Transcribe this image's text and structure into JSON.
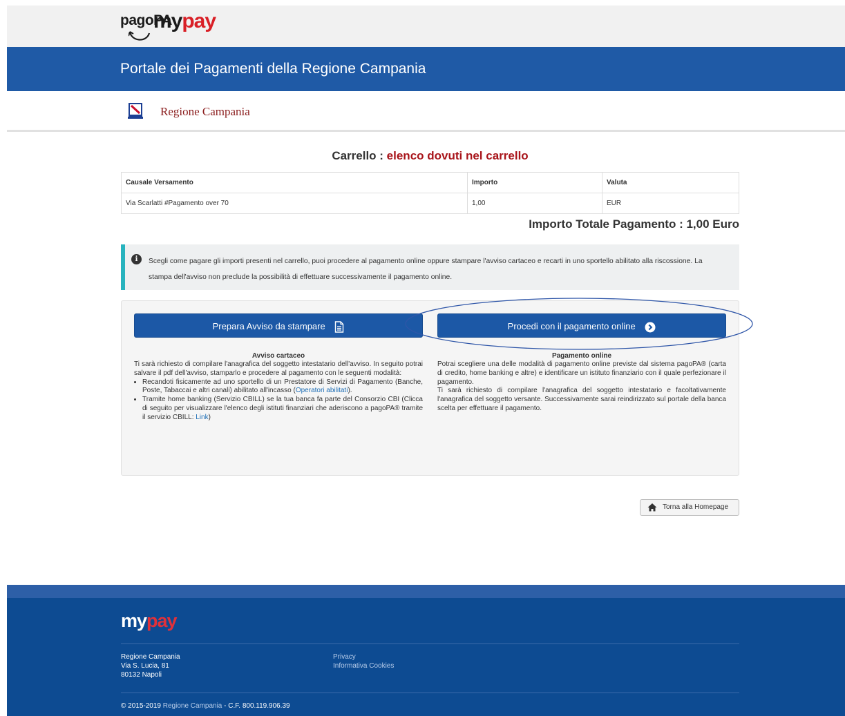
{
  "brand": {
    "pagopa": "pagoPA",
    "mypay_my": "my",
    "mypay_pay": "pay"
  },
  "header": {
    "title": "Portale dei Pagamenti della Regione Campania"
  },
  "region": {
    "name": "Regione Campania"
  },
  "cart": {
    "title_prefix": "Carrello : ",
    "title_highlight": "elenco dovuti nel carrello",
    "columns": [
      "Causale Versamento",
      "Importo",
      "Valuta"
    ],
    "rows": [
      {
        "causale": "Via Scarlatti #Pagamento over 70",
        "importo": "1,00",
        "valuta": "EUR"
      }
    ],
    "total": "Importo Totale Pagamento : 1,00 Euro"
  },
  "info": {
    "text": "Scegli come pagare gli importi presenti nel carrello, puoi procedere al pagamento online oppure stampare l'avviso cartaceo e recarti in uno sportello abilitato alla riscossione. La stampa dell'avviso non preclude la possibilità di effettuare successivamente il pagamento online."
  },
  "options": {
    "avviso": {
      "button_label": "Prepara Avviso da stampare",
      "title": "Avviso cartaceo",
      "intro": "Ti sarà richiesto di compilare l'anagrafica del soggetto intestatario dell'avviso. In seguito potrai salvare il pdf dell'avviso, stamparlo e procedere al pagamento con le seguenti modalità:",
      "bullet1_text": "Recandoti fisicamente ad uno sportello di un Prestatore di Servizi di Pagamento (Banche, Poste, Tabaccai e altri canali) abilitato all'incasso (",
      "bullet1_link": "Operatori abilitati",
      "bullet1_end": ").",
      "bullet2_text": "Tramite home banking (Servizio CBILL) se la tua banca fa parte del Consorzio CBI (Clicca di seguito per visualizzare l'elenco degli istituti finanziari che aderiscono a pagoPA® tramite il servizio CBILL: ",
      "bullet2_link": "Link",
      "bullet2_end": ")"
    },
    "online": {
      "button_label": "Procedi con il pagamento online",
      "title": "Pagamento online",
      "para1": "Potrai scegliere una delle modalità di pagamento online previste dal sistema pagoPA® (carta di credito, home banking e altre) e identificare un istituto finanziario con il quale perfezionare il pagamento.",
      "para2": "Ti sarà richiesto di compilare l'anagrafica del soggetto intestatario e facoltativamente l'anagrafica del soggetto versante. Successivamente sarai reindirizzato sul portale della banca scelta per effettuare il pagamento."
    }
  },
  "home_button": {
    "label": "Torna alla Homepage"
  },
  "footer": {
    "logo_my": "my",
    "logo_pay": "pay",
    "address": [
      "Regione Campania",
      "Via S. Lucia, 81",
      "80132 Napoli"
    ],
    "links": [
      "Privacy",
      "Informativa Cookies"
    ],
    "copyright_prefix": "© 2015-2019 ",
    "copyright_link": "Regione Campania",
    "copyright_suffix": " - C.F. 800.119.906.39"
  },
  "colors": {
    "header_blue": "#1f5aa6",
    "footer_blue": "#0d4b92",
    "accent_red": "#a8141a",
    "info_border": "#27b3be"
  }
}
